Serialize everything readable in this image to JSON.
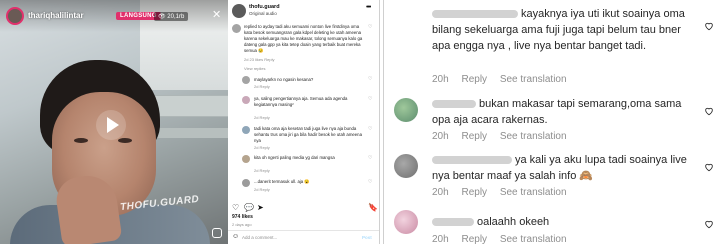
{
  "video": {
    "username": "thariqhalilintar",
    "live_badge": "LANGSUNG",
    "viewer_count": "20,1rb",
    "watermark": "THOFU.GUARD"
  },
  "post": {
    "account_name": "thofu.guard",
    "audio": "Original audio",
    "comments": [
      {
        "text": "replied to ayday tadi aku semuami nonton live firstdinya oma kata besok semuangsran gala kdpel deleting ke utah ameena karena sekeluarga mau ke makasar, tolong semuanya kalo ga dateng gala gpp ya kita tetep doain yang terbaik buat mereka semua 😢",
        "meta": "2d  23 likes  Reply"
      },
      {
        "text": "maylayarkn no ngasin kesana?",
        "meta": "2d  Reply"
      },
      {
        "text": "ya, saling pengertiannya aja. Semua ada agenda kegiatannya masing²",
        "meta": "2d  Reply"
      },
      {
        "text": "tadi kata oma aja kesetan tadi juga live nya aja bunda sehantu trus oma jiri ga bila hadir besok ke utah ameena nya",
        "meta": "2d  Reply"
      },
      {
        "text": "kita oh ngerti paling media yg dari mangsa",
        "meta": "2d  Reply"
      },
      {
        "text": "...danerit termasuk ull. aja 😮",
        "meta": "2d  Reply"
      }
    ],
    "view_more": "View replies",
    "likes": "974 likes",
    "date": "2 days ago",
    "add_comment_placeholder": "Add a comment...",
    "post_button": "Post"
  },
  "zoom": {
    "comments": [
      {
        "text": "kayaknya iya uti ikut soainya oma bilang sekeluarga ama fuji juga tapi belum tau bner apa engga nya , live nya bentar banget tadi.",
        "time": "20h",
        "reply": "Reply",
        "translate": "See translation"
      },
      {
        "text": "bukan makasar tapi semarang,oma sama opa aja acara rakernas.",
        "time": "20h",
        "reply": "Reply",
        "translate": "See translation"
      },
      {
        "text": "ya kali ya aku lupa tadi soainya live nya bentar maaf ya salah info 🙈",
        "time": "20h",
        "reply": "Reply",
        "translate": "See translation"
      },
      {
        "text": "oalaahh okeeh",
        "time": "20h",
        "reply": "Reply",
        "translate": "See translation"
      }
    ]
  },
  "colors": {
    "live_accent": "#e1306c",
    "meta_gray": "#8e8e8e"
  },
  "icons": [
    "play-icon",
    "heart-icon",
    "comment-icon",
    "share-icon",
    "bookmark-icon",
    "more-icon",
    "close-icon",
    "instagram-icon",
    "emoji-icon"
  ]
}
